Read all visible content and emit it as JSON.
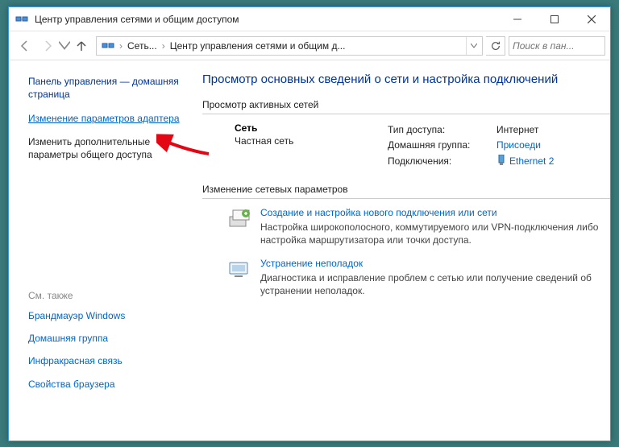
{
  "window": {
    "title": "Центр управления сетями и общим доступом"
  },
  "nav": {
    "crumb1": "Сеть...",
    "crumb2": "Центр управления сетями и общим д...",
    "search_placeholder": "Поиск в пан..."
  },
  "sidebar": {
    "home": "Панель управления — домашняя страница",
    "adapter": "Изменение параметров адаптера",
    "sharing": "Изменить дополнительные параметры общего доступа",
    "also_header": "См. также",
    "also": {
      "firewall": "Брандмауэр Windows",
      "homegroup": "Домашняя группа",
      "irda": "Инфракрасная связь",
      "browser": "Свойства браузера"
    }
  },
  "main": {
    "heading": "Просмотр основных сведений о сети и настройка подключений",
    "active_group": "Просмотр активных сетей",
    "network": {
      "name": "Сеть",
      "subtitle": "Частная сеть",
      "access_label": "Тип доступа:",
      "access_value": "Интернет",
      "homegroup_label": "Домашняя группа:",
      "homegroup_value": "Присоеди",
      "conn_label": "Подключения:",
      "conn_value": "Ethernet 2"
    },
    "change_group": "Изменение сетевых параметров",
    "opt1": {
      "title": "Создание и настройка нового подключения или сети",
      "desc": "Настройка широкополосного, коммутируемого или VPN-подключения либо настройка маршрутизатора или точки доступа."
    },
    "opt2": {
      "title": "Устранение неполадок",
      "desc": "Диагностика и исправление проблем с сетью или получение сведений об устранении неполадок."
    }
  }
}
